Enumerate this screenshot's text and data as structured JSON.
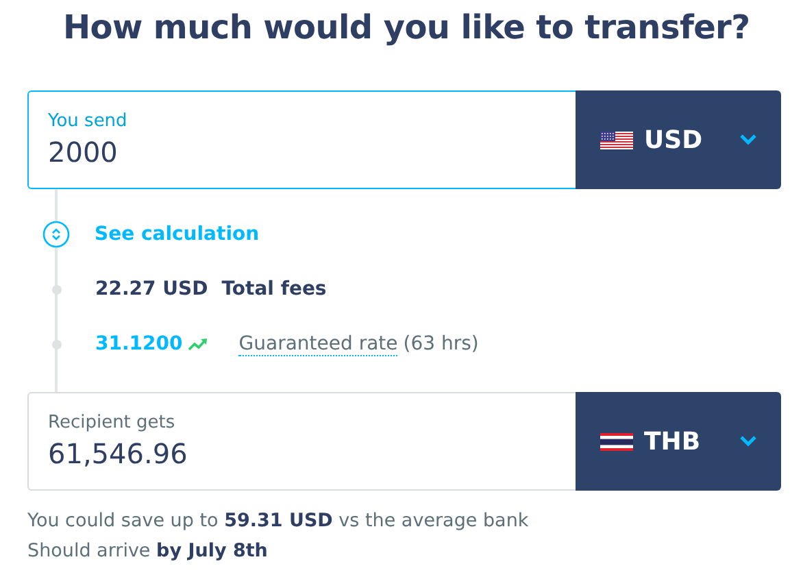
{
  "title": "How much would you like to transfer?",
  "send": {
    "label": "You send",
    "value": "2000",
    "focused": true,
    "currency": {
      "code": "USD",
      "flag": {
        "kind": "us"
      }
    }
  },
  "calculation": {
    "toggle": "See calculation",
    "expanded": false,
    "fees": {
      "amount": "22.27 USD",
      "label": "Total fees"
    },
    "rate": {
      "value": "31.1200",
      "rising": true,
      "label": "Guaranteed rate",
      "duration": "(63 hrs)"
    }
  },
  "receive": {
    "label": "Recipient gets",
    "value": "61,546.96",
    "focused": false,
    "currency": {
      "code": "THB",
      "flag": {
        "kind": "th"
      }
    }
  },
  "notes": [
    "You could save up to **59.31 USD** vs the average bank",
    "Should arrive **by July 8th**"
  ]
}
